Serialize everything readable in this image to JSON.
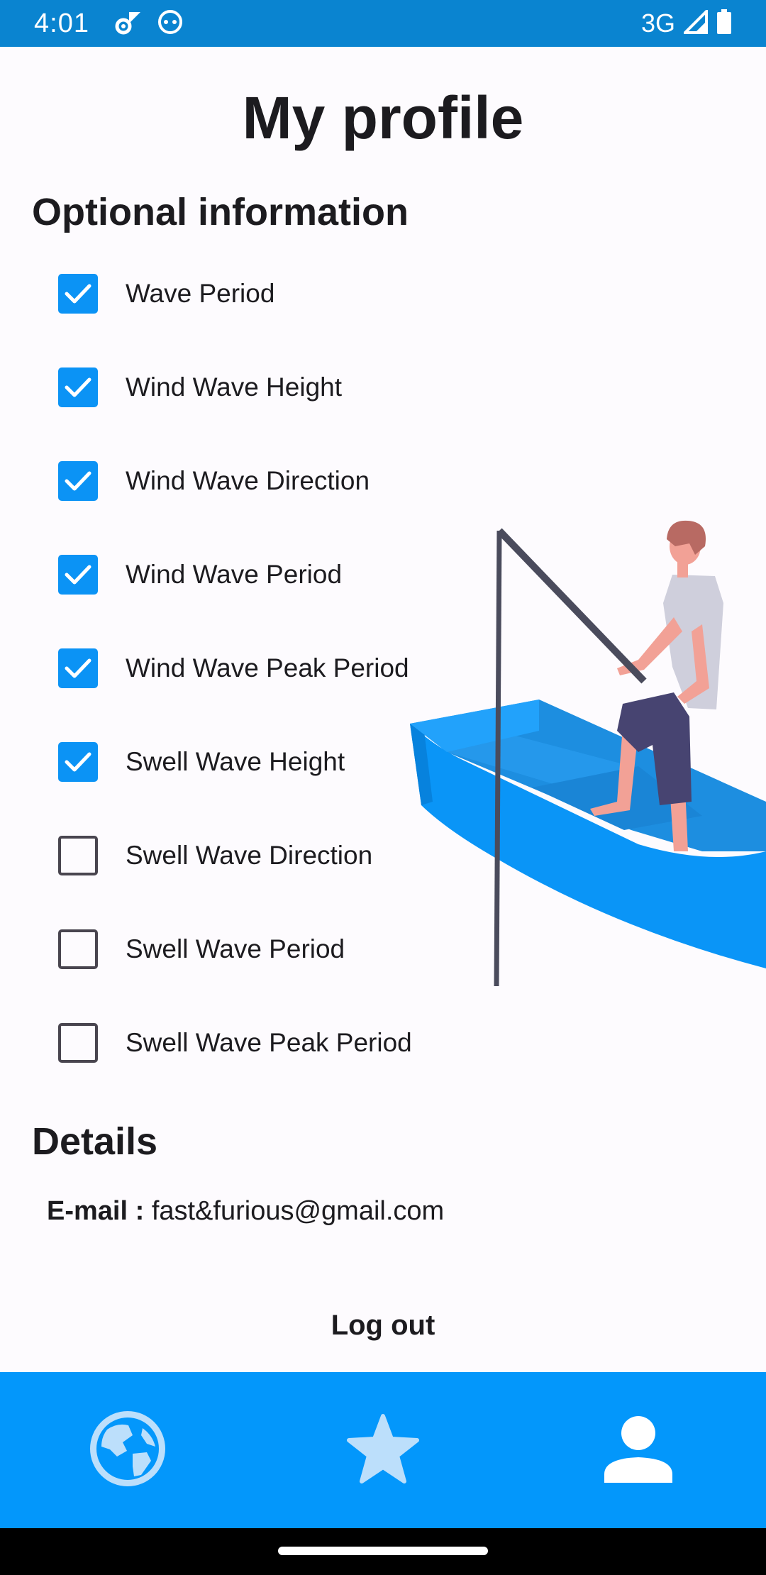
{
  "status_bar": {
    "time": "4:01",
    "network": "3G",
    "icons": [
      "settings-sync-icon",
      "android-icon",
      "signal-icon",
      "battery-icon"
    ]
  },
  "page": {
    "title": "My profile"
  },
  "optional_info": {
    "heading": "Optional information",
    "options": [
      {
        "label": "Wave Period",
        "checked": true
      },
      {
        "label": "Wind Wave Height",
        "checked": true
      },
      {
        "label": "Wind Wave Direction",
        "checked": true
      },
      {
        "label": "Wind Wave Period",
        "checked": true
      },
      {
        "label": "Wind Wave Peak Period",
        "checked": true
      },
      {
        "label": "Swell Wave Height",
        "checked": true
      },
      {
        "label": "Swell Wave Direction",
        "checked": false
      },
      {
        "label": "Swell Wave Period",
        "checked": false
      },
      {
        "label": "Swell Wave Peak Period",
        "checked": false
      }
    ]
  },
  "details": {
    "heading": "Details",
    "email_label": "E-mail :",
    "email_value": "fast&furious@gmail.com"
  },
  "actions": {
    "logout_label": "Log out"
  },
  "bottom_nav": {
    "items": [
      "globe-icon",
      "star-icon",
      "person-icon"
    ]
  },
  "colors": {
    "accent": "#0b93f5",
    "nav_bg": "#0397fb",
    "status_bar": "#0a84d0"
  }
}
